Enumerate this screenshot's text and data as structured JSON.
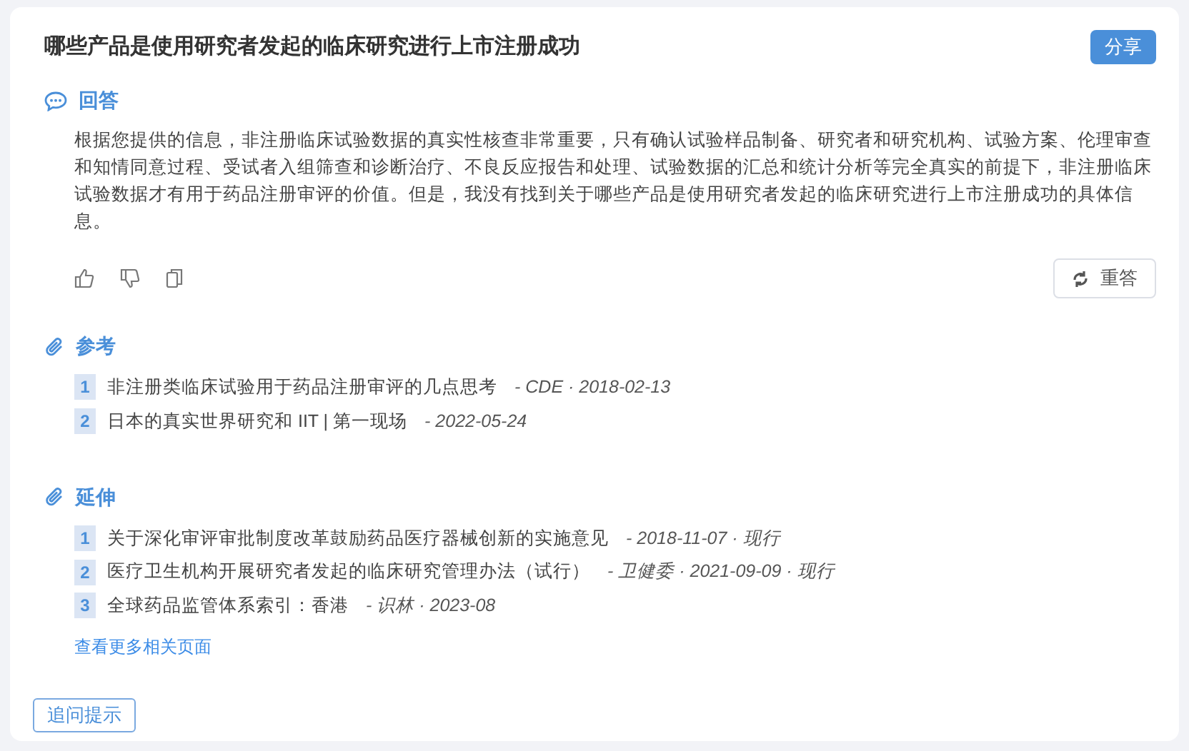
{
  "question": "哪些产品是使用研究者发起的临床研究进行上市注册成功",
  "share_button": "分享",
  "answer": {
    "heading": "回答",
    "text": "根据您提供的信息，非注册临床试验数据的真实性核查非常重要，只有确认试验样品制备、研究者和研究机构、试验方案、伦理审查和知情同意过程、受试者入组筛查和诊断治疗、不良反应报告和处理、试验数据的汇总和统计分析等完全真实的前提下，非注册临床试验数据才有用于药品注册审评的价值。但是，我没有找到关于哪些产品是使用研究者发起的临床研究进行上市注册成功的具体信息。",
    "retry_button": "重答"
  },
  "sections": [
    {
      "heading": "参考",
      "items": [
        {
          "number": "1",
          "title": "非注册类临床试验用于药品注册审评的几点思考",
          "meta": "- CDE · 2018-02-13"
        },
        {
          "number": "2",
          "title": "日本的真实世界研究和 IIT | 第一现场",
          "meta": "- 2022-05-24"
        }
      ]
    },
    {
      "heading": "延伸",
      "items": [
        {
          "number": "1",
          "title": "关于深化审评审批制度改革鼓励药品医疗器械创新的实施意见",
          "meta": "- 2018-11-07 · 现行"
        },
        {
          "number": "2",
          "title": "医疗卫生机构开展研究者发起的临床研究管理办法（试行）",
          "meta": "- 卫健委 · 2021-09-09 · 现行"
        },
        {
          "number": "3",
          "title": "全球药品监管体系索引：香港",
          "meta": "- 识林 · 2023-08"
        }
      ],
      "more_link": "查看更多相关页面"
    }
  ],
  "follow_up_button": "追问提示"
}
